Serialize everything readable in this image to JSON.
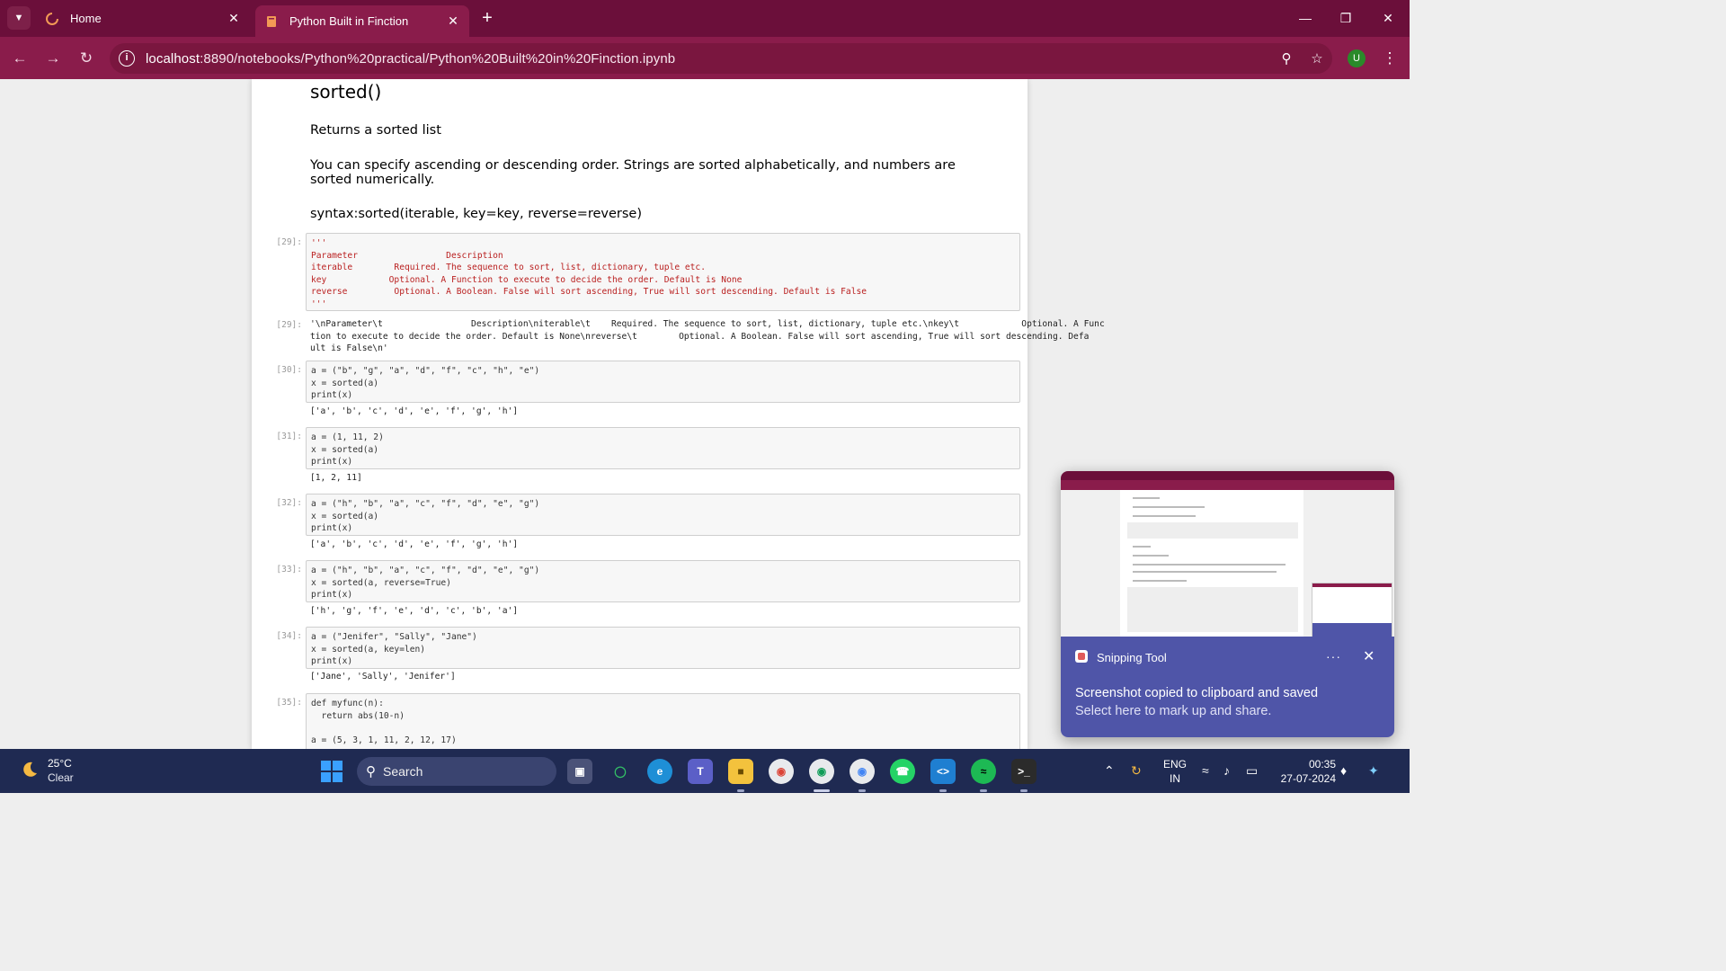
{
  "browser": {
    "tabs": [
      {
        "label": "Home",
        "active": false
      },
      {
        "label": "Python Built in Finction",
        "active": true
      }
    ],
    "url_host": "localhost",
    "url_rest": ":8890/notebooks/Python%20practical/Python%20Built%20in%20Finction.ipynb",
    "profile_initial": "U",
    "icons": {
      "tab_menu": "chevron-down-icon",
      "close": "close-icon",
      "new_tab": "plus-icon",
      "minimize": "minimize-icon",
      "restore": "restore-icon",
      "win_close": "close-icon",
      "back": "arrow-left-icon",
      "forward": "arrow-right-icon",
      "reload": "reload-icon",
      "site_info": "info-icon",
      "zoom": "zoom-icon",
      "bookmark": "star-icon",
      "menu": "kebab-menu-icon"
    },
    "colors": {
      "titlebar": "#6b0f3a",
      "toolbar": "#8a1c4b"
    }
  },
  "notebook": {
    "heading": "sorted()",
    "para1": "Returns a sorted list",
    "para2": "You can specify ascending or descending order. Strings are sorted alphabetically, and numbers are sorted numerically.",
    "para3": "syntax:sorted(iterable, key=key, reverse=reverse)",
    "cells": [
      {
        "prompt_in": "[29]:",
        "code": "'''\nParameter                 Description\niterable        Required. The sequence to sort, list, dictionary, tuple etc.\nkey            Optional. A Function to execute to decide the order. Default is None\nreverse         Optional. A Boolean. False will sort ascending, True will sort descending. Default is False\n'''",
        "prompt_out": "[29]:",
        "output": "'\\nParameter\\t                 Description\\niterable\\t    Required. The sequence to sort, list, dictionary, tuple etc.\\nkey\\t            Optional. A Func\ntion to execute to decide the order. Default is None\\nreverse\\t        Optional. A Boolean. False will sort ascending, True will sort descending. Defa\nult is False\\n'"
      },
      {
        "prompt_in": "[30]:",
        "code": "a = (\"b\", \"g\", \"a\", \"d\", \"f\", \"c\", \"h\", \"e\")\nx = sorted(a)\nprint(x)",
        "output": "['a', 'b', 'c', 'd', 'e', 'f', 'g', 'h']"
      },
      {
        "prompt_in": "[31]:",
        "code": "a = (1, 11, 2)\nx = sorted(a)\nprint(x)",
        "output": "[1, 2, 11]"
      },
      {
        "prompt_in": "[32]:",
        "code": "a = (\"h\", \"b\", \"a\", \"c\", \"f\", \"d\", \"e\", \"g\")\nx = sorted(a)\nprint(x)",
        "output": "['a', 'b', 'c', 'd', 'e', 'f', 'g', 'h']"
      },
      {
        "prompt_in": "[33]:",
        "code": "a = (\"h\", \"b\", \"a\", \"c\", \"f\", \"d\", \"e\", \"g\")\nx = sorted(a, reverse=True)\nprint(x)",
        "output": "['h', 'g', 'f', 'e', 'd', 'c', 'b', 'a']"
      },
      {
        "prompt_in": "[34]:",
        "code": "a = (\"Jenifer\", \"Sally\", \"Jane\")\nx = sorted(a, key=len)\nprint(x)",
        "output": "['Jane', 'Sally', 'Jenifer']"
      },
      {
        "prompt_in": "[35]:",
        "code": "def myfunc(n):\n  return abs(10-n)\n\na = (5, 3, 1, 11, 2, 12, 17)"
      }
    ]
  },
  "toast": {
    "app": "Snipping Tool",
    "more": "···",
    "title": "Screenshot copied to clipboard and saved",
    "subtitle": "Select here to mark up and share."
  },
  "taskbar": {
    "weather_temp": "25°C",
    "weather_desc": "Clear",
    "search_label": "Search",
    "lang1": "ENG",
    "lang2": "IN",
    "time": "00:35",
    "date": "27-07-2024",
    "apps": [
      "task-view-icon",
      "copilot-icon",
      "edge-icon",
      "teams-icon",
      "file-explorer-icon",
      "chrome-icon",
      "chrome-profile-icon",
      "chrome-alt-icon",
      "whatsapp-icon",
      "vscode-icon",
      "spotify-icon",
      "terminal-icon"
    ],
    "tray_icons": [
      "chevron-up-icon",
      "sync-icon",
      "wifi-icon",
      "volume-icon",
      "battery-icon",
      "bell-icon",
      "copilot-pre-icon"
    ]
  }
}
